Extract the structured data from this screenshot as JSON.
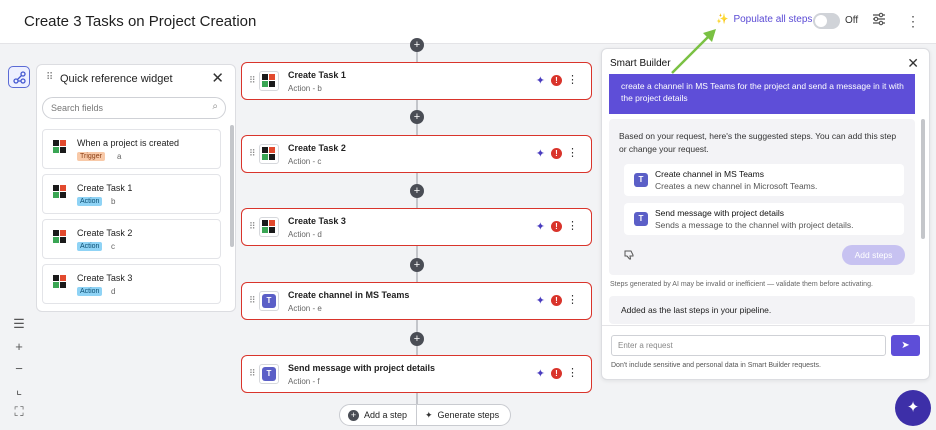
{
  "header": {
    "title": "Create 3 Tasks on Project Creation",
    "populate_label": "Populate all steps",
    "toggle_label": "Off"
  },
  "quick_ref": {
    "title": "Quick reference widget",
    "search_placeholder": "Search fields",
    "items": [
      {
        "name": "When a project is created",
        "badge": "Trigger",
        "ref": "a"
      },
      {
        "name": "Create Task 1",
        "badge": "Action",
        "ref": "b"
      },
      {
        "name": "Create Task 2",
        "badge": "Action",
        "ref": "c"
      },
      {
        "name": "Create Task 3",
        "badge": "Action",
        "ref": "d"
      }
    ]
  },
  "canvas": {
    "steps": [
      {
        "name": "Create Task 1",
        "sub": "Action - b",
        "app": "zoho"
      },
      {
        "name": "Create Task 2",
        "sub": "Action - c",
        "app": "zoho"
      },
      {
        "name": "Create Task 3",
        "sub": "Action - d",
        "app": "zoho"
      },
      {
        "name": "Create channel in MS Teams",
        "sub": "Action - e",
        "app": "teams"
      },
      {
        "name": "Send message with project details",
        "sub": "Action - f",
        "app": "teams"
      }
    ],
    "add_step_label": "Add a step",
    "generate_steps_label": "Generate steps",
    "error_mark": "!"
  },
  "smart_builder": {
    "title": "Smart Builder",
    "prompt": "create a channel in MS Teams for the project and send a message in it with the project details",
    "intro": "Based on your request, here's the suggested steps. You can add this step or change your request.",
    "suggestions": [
      {
        "name": "Create channel in MS Teams",
        "desc": "Creates a new channel in Microsoft Teams."
      },
      {
        "name": "Send message with project details",
        "desc": "Sends a message to the channel with project details."
      }
    ],
    "add_steps_label": "Add steps",
    "ai_note": "Steps generated by AI may be invalid or inefficient — validate them before activating.",
    "added_note": "Added as the last steps in your pipeline.",
    "input_placeholder": "Enter a request",
    "disclaimer": "Don't include sensitive and personal data in Smart Builder requests."
  },
  "colors": {
    "accent": "#5e4ed8",
    "error": "#d9342b",
    "arrow": "#7ac143"
  }
}
